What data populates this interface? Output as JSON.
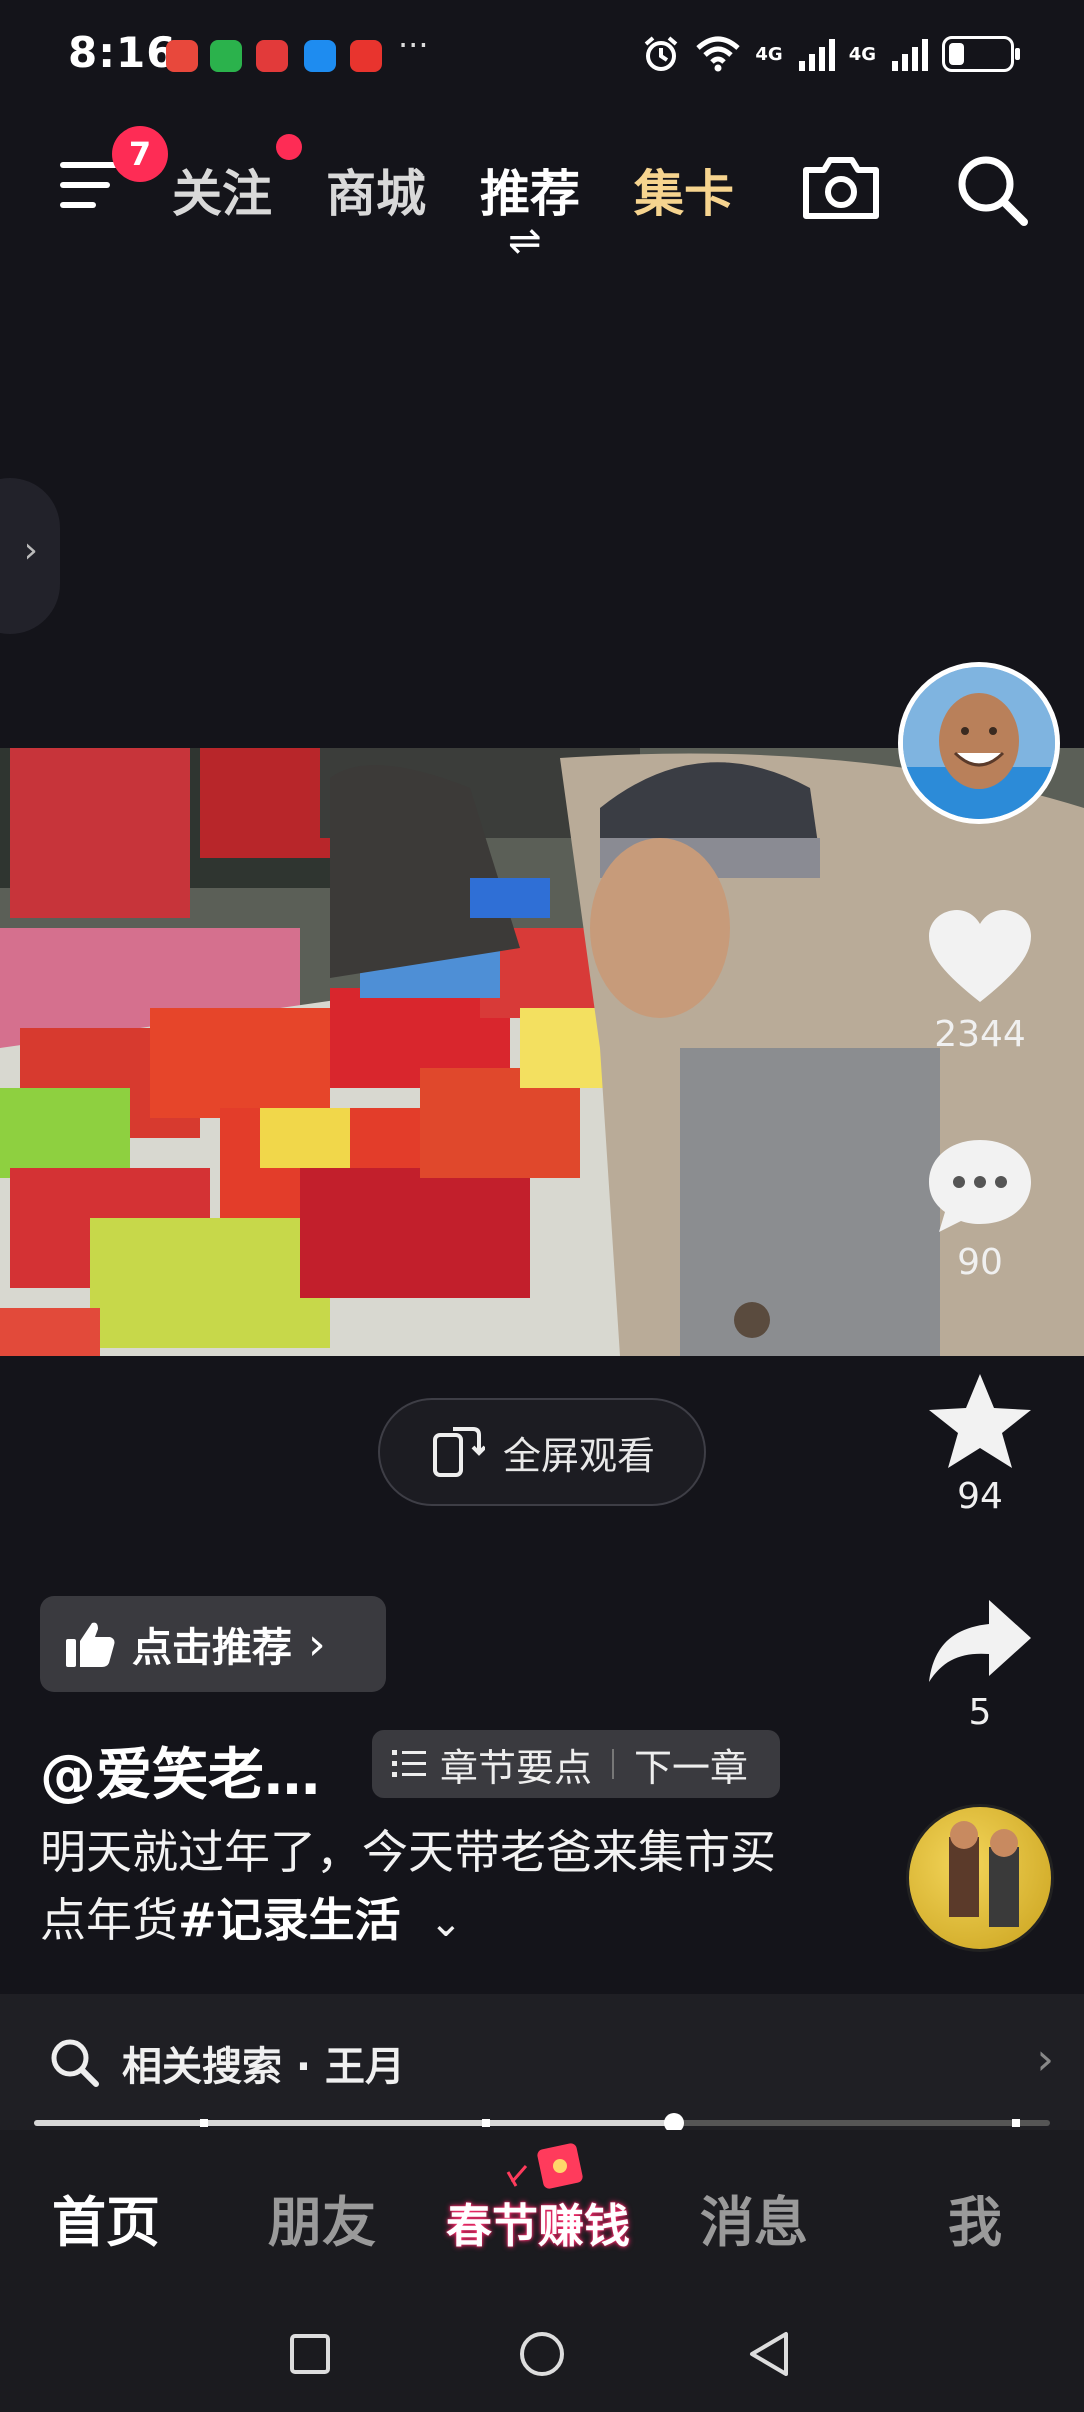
{
  "status_bar": {
    "time": "8:16",
    "more": "···",
    "network_1": "4G",
    "network_2": "4G",
    "battery_percent": 25
  },
  "top_nav": {
    "menu_badge": "7",
    "tabs": [
      {
        "label": "关注"
      },
      {
        "label": "商城"
      },
      {
        "label": "推荐"
      },
      {
        "label": "集卡"
      }
    ],
    "swap_glyph": "⇌"
  },
  "video": {
    "fullscreen_label": "全屏观看"
  },
  "right_rail": {
    "likes": "2344",
    "comments": "90",
    "favorites": "94",
    "shares": "5"
  },
  "post": {
    "recommend_label": "点击推荐",
    "author": "@爱笑老…",
    "chapter_label": "章节要点",
    "next_chapter_label": "下一章",
    "caption_text": "明天就过年了，今天带老爸来集市买点年货",
    "caption_tag": "#记录生活",
    "expand_glyph": "⌄"
  },
  "related_search": {
    "text": "相关搜索 · 王月"
  },
  "progress": {
    "played_fraction": 0.63
  },
  "bottom_nav": {
    "home": "首页",
    "friends": "朋友",
    "festival": "春节赚钱",
    "messages": "消息",
    "me": "我"
  },
  "colors": {
    "accent_red": "#fe2c55",
    "gold_tab": "#f6d48f",
    "background": "#14141a"
  }
}
